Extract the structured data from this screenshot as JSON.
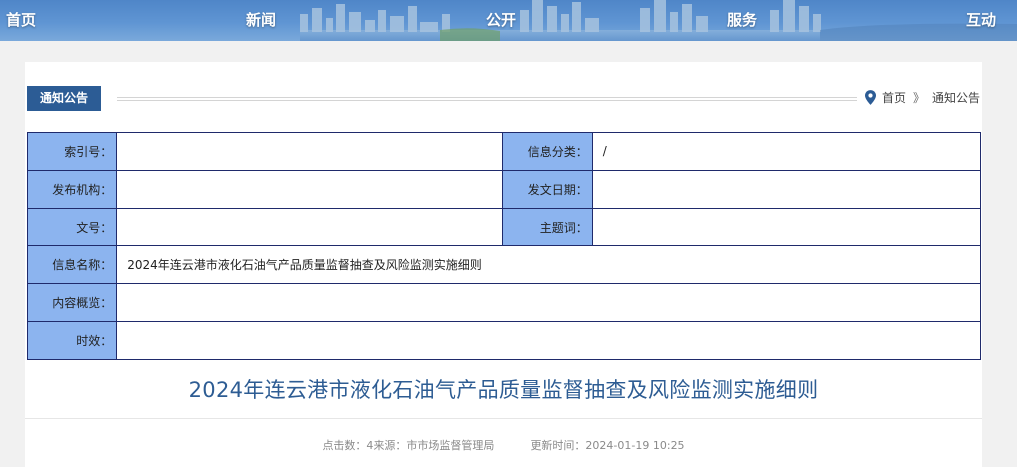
{
  "nav": {
    "home": "首页",
    "news": "新闻",
    "public": "公开",
    "service": "服务",
    "interact": "互动"
  },
  "section": {
    "tab": "通知公告"
  },
  "breadcrumb": {
    "home": "首页",
    "separator": "》",
    "current": "通知公告"
  },
  "info": {
    "index_label": "索引号：",
    "index_value": "",
    "category_label": "信息分类：",
    "category_value": "/",
    "publisher_label": "发布机构：",
    "publisher_value": "",
    "date_label": "发文日期：",
    "date_value": "",
    "docno_label": "文号：",
    "docno_value": "",
    "subject_label": "主题词：",
    "subject_value": "",
    "name_label": "信息名称：",
    "name_value": "2024年连云港市液化石油气产品质量监督抽查及风险监测实施细则",
    "summary_label": "内容概览：",
    "summary_value": "",
    "validity_label": "时效：",
    "validity_value": ""
  },
  "article": {
    "title": "2024年连云港市液化石油气产品质量监督抽查及风险监测实施细则",
    "clicks": "点击数：4",
    "source": "来源：市市场监督管理局",
    "updated": "更新时间：2024-01-19 10:25"
  },
  "colors": {
    "banner": "#5f95d3",
    "tab": "#2c5c95",
    "label_cell": "#8cb4ef",
    "table_border": "#1f2a6b",
    "title": "#2d5c93"
  },
  "icons": {
    "breadcrumb": "map-pin-icon"
  }
}
